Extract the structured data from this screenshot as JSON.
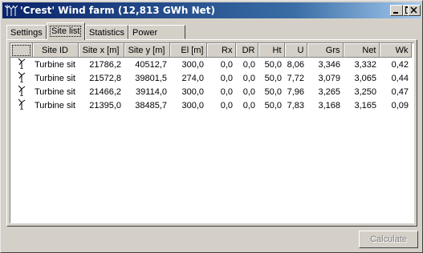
{
  "window": {
    "title": "'Crest' Wind farm (12,813 GWh Net)",
    "icon": "wind-turbine-icon"
  },
  "tabs": [
    {
      "label": "Settings",
      "active": false
    },
    {
      "label": "Site list",
      "active": true
    },
    {
      "label": "Statistics",
      "active": false
    },
    {
      "label": "Power curve",
      "active": false
    }
  ],
  "table": {
    "columns": [
      "",
      "Site ID",
      "Site x [m]",
      "Site y [m]",
      "El [m]",
      "Rx",
      "DR",
      "Ht",
      "U",
      "Grs",
      "Net",
      "Wk"
    ],
    "rows": [
      {
        "id": "Turbine sit",
        "x": "21786,2",
        "y": "40512,7",
        "el": "300,0",
        "rx": "0,0",
        "dr": "0,0",
        "ht": "50,0",
        "u": "8,06",
        "grs": "3,346",
        "net": "3,332",
        "wk": "0,42"
      },
      {
        "id": "Turbine sit",
        "x": "21572,8",
        "y": "39801,5",
        "el": "274,0",
        "rx": "0,0",
        "dr": "0,0",
        "ht": "50,0",
        "u": "7,72",
        "grs": "3,079",
        "net": "3,065",
        "wk": "0,44"
      },
      {
        "id": "Turbine sit",
        "x": "21466,2",
        "y": "39114,0",
        "el": "300,0",
        "rx": "0,0",
        "dr": "0,0",
        "ht": "50,0",
        "u": "7,96",
        "grs": "3,265",
        "net": "3,250",
        "wk": "0,47"
      },
      {
        "id": "Turbine sit",
        "x": "21395,0",
        "y": "38485,7",
        "el": "300,0",
        "rx": "0,0",
        "dr": "0,0",
        "ht": "50,0",
        "u": "7,83",
        "grs": "3,168",
        "net": "3,165",
        "wk": "0,09"
      }
    ]
  },
  "buttons": {
    "calculate": "Calculate",
    "calculate_enabled": false
  }
}
